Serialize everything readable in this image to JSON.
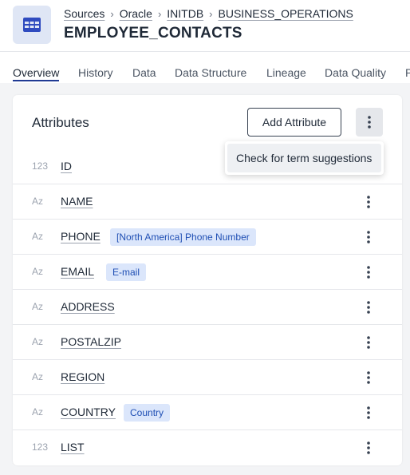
{
  "header": {
    "icon": "table-icon",
    "breadcrumb": [
      "Sources",
      "Oracle",
      "INITDB",
      "BUSINESS_OPERATIONS"
    ],
    "title": "EMPLOYEE_CONTACTS"
  },
  "tabs": [
    "Overview",
    "History",
    "Data",
    "Data Structure",
    "Lineage",
    "Data Quality",
    "P"
  ],
  "active_tab": "Overview",
  "attributes": {
    "title": "Attributes",
    "add_label": "Add Attribute",
    "more_icon": "vertical-dots-icon",
    "menu_item": "Check for term suggestions",
    "rows": [
      {
        "type": "123",
        "name": "ID",
        "tag": ""
      },
      {
        "type": "Az",
        "name": "NAME",
        "tag": ""
      },
      {
        "type": "Az",
        "name": "PHONE",
        "tag": "[North America] Phone Number"
      },
      {
        "type": "Az",
        "name": "EMAIL",
        "tag": "E-mail"
      },
      {
        "type": "Az",
        "name": "ADDRESS",
        "tag": ""
      },
      {
        "type": "Az",
        "name": "POSTALZIP",
        "tag": ""
      },
      {
        "type": "Az",
        "name": "REGION",
        "tag": ""
      },
      {
        "type": "Az",
        "name": "COUNTRY",
        "tag": "Country"
      },
      {
        "type": "123",
        "name": "LIST",
        "tag": ""
      }
    ]
  },
  "colors": {
    "accent": "#1f3a93",
    "tag_bg": "#dbe6fb",
    "tag_text": "#1f4fb4",
    "icon_bg": "#dfe6f5"
  }
}
